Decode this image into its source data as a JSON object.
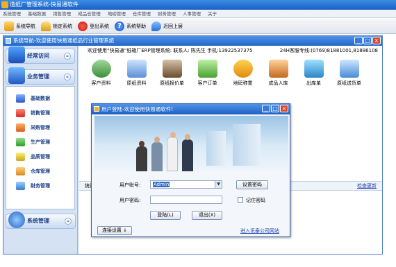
{
  "app": {
    "title": "造纸厂管理系统-快易通软件"
  },
  "menubar": {
    "items": [
      "系统管理",
      "基础数据",
      "销售管理",
      "成品仓管理",
      "地磅管理",
      "仓库管理",
      "财务管理",
      "人事管理",
      "关于"
    ]
  },
  "toolbar": {
    "nav": "系统导航",
    "lock": "锁定系统",
    "logout": "登出系统",
    "help": "系统帮助",
    "recent": "近回上层"
  },
  "inner": {
    "title": "系统导航-欢迎使用快易通纸品行业管理系统",
    "welcome": "欢迎使用“快易通”纸箱厂ERP管理系统: 联系人: 陈先生 手机:13922537375",
    "hotline": "24H客服专线:(0769)81881001,81886108"
  },
  "sidebar": {
    "section1": "经常访问",
    "section2": "业务管理",
    "section3": "系统管理",
    "items": [
      {
        "label": "基础数据"
      },
      {
        "label": "销售管理"
      },
      {
        "label": "采购管理"
      },
      {
        "label": "生产管理"
      },
      {
        "label": "品质管理"
      },
      {
        "label": "仓库管理"
      },
      {
        "label": "财务管理"
      }
    ]
  },
  "quick_icons": [
    {
      "label": "客户资料"
    },
    {
      "label": "原纸资料"
    },
    {
      "label": "原纸报价单"
    },
    {
      "label": "客户订单"
    },
    {
      "label": "地磅称重"
    },
    {
      "label": "成品入库"
    },
    {
      "label": "出库单"
    },
    {
      "label": "原纸送货单"
    }
  ],
  "stats": {
    "label": "统计",
    "more": "检查更新"
  },
  "dialog": {
    "title": "用户登陆-欢迎使用快易通软件!",
    "username_label": "用户账号:",
    "username_value": "Admin",
    "password_label": "用户密码:",
    "set_password": "设置密码",
    "remember": "记住密码",
    "login": "登陆(L)",
    "exit": "退出(X)",
    "connect": "连接设置",
    "website": "进入讯泰公司网站"
  },
  "colors": {
    "title_blue": "#1a5fc4",
    "sidebar_bg": "#d4e2f4",
    "link_blue": "#1a3fb0"
  }
}
